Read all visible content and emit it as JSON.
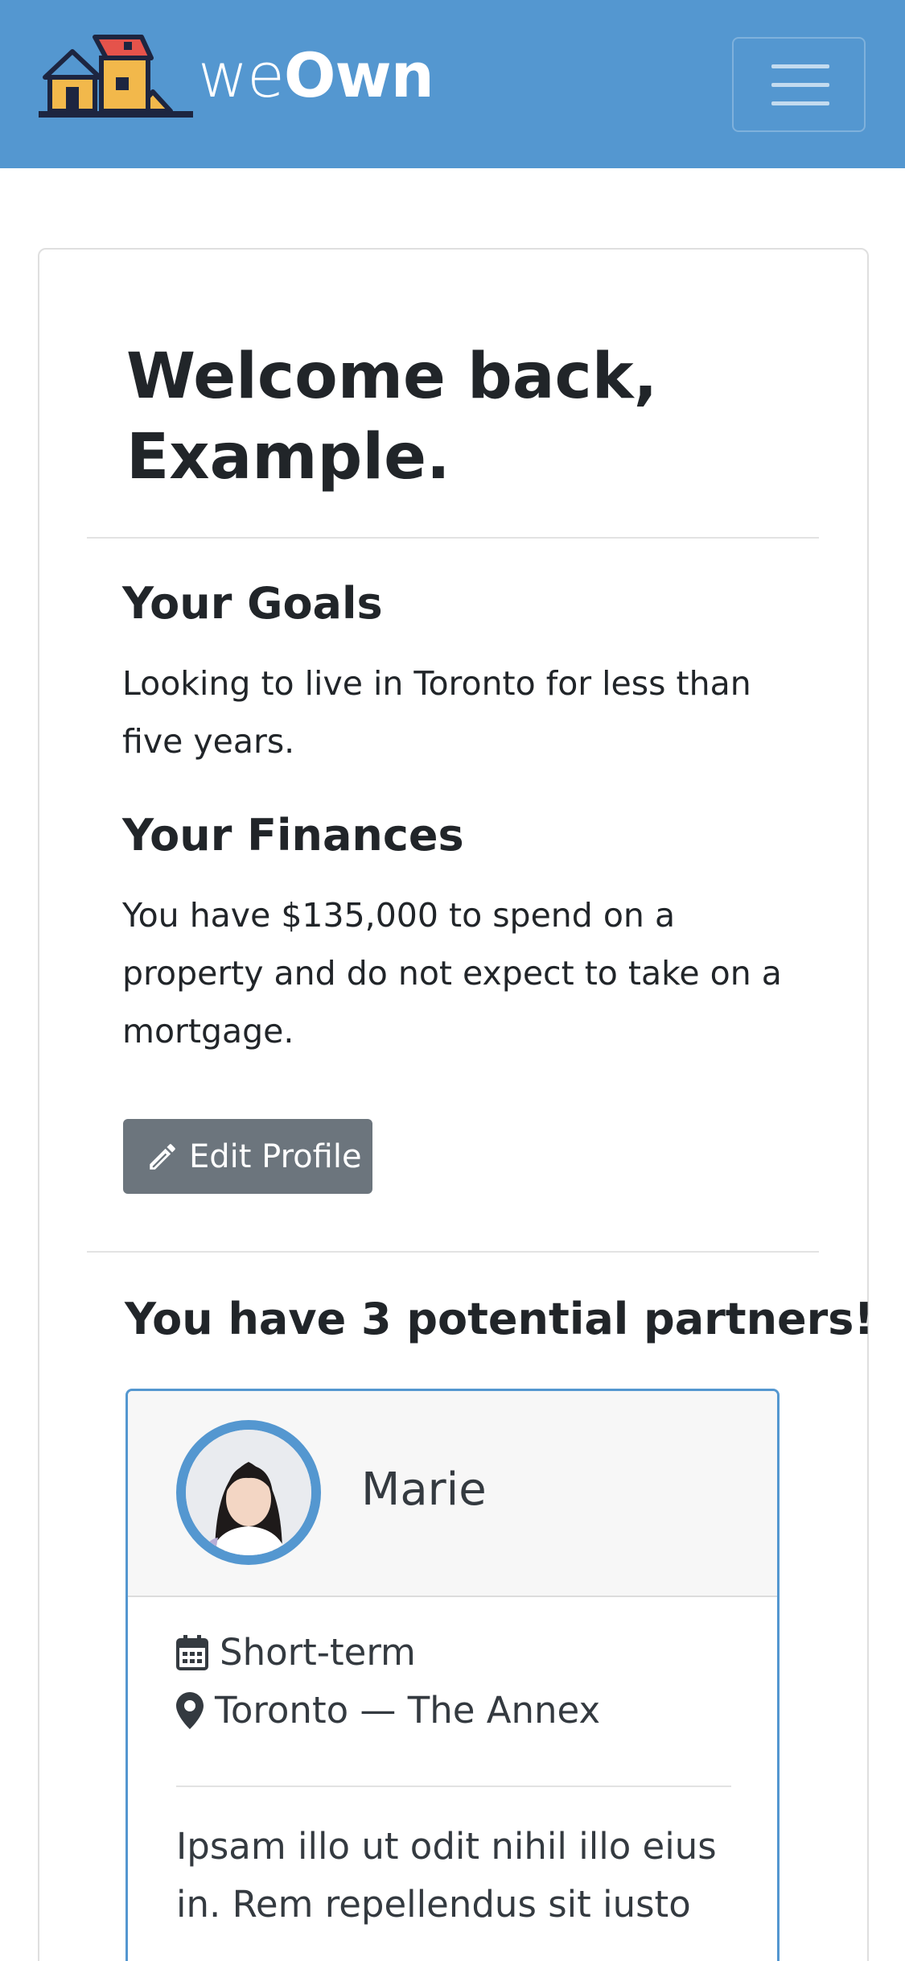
{
  "header": {
    "brand_light": "we",
    "brand_bold": "Own",
    "menu_icon": "hamburger-menu-icon",
    "logo_icon": "houses-logo-icon",
    "accent_color": "#5497d0"
  },
  "main": {
    "welcome_title": "Welcome back, Example.",
    "goals": {
      "heading": "Your Goals",
      "text": "Looking to live in Toronto for less than five years."
    },
    "finances": {
      "heading": "Your Finances",
      "text": "You have $135,000 to spend on a property and do not expect to take on a mortgage."
    },
    "edit_button": {
      "label": "Edit Profile",
      "icon": "pencil-icon"
    },
    "partners_heading": "You have 3 potential partners!",
    "partner": {
      "name": "Marie",
      "term": "Short-term",
      "term_icon": "calendar-icon",
      "location": "Toronto — The Annex",
      "location_icon": "map-marker-icon",
      "bio": "Ipsam illo ut odit nihil illo eius in. Rem repellendus sit iusto"
    }
  }
}
